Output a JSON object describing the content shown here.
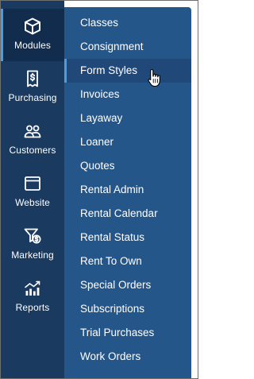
{
  "sidebar": {
    "items": [
      {
        "label": "Modules",
        "icon": "cube-icon",
        "active": true
      },
      {
        "label": "Purchasing",
        "icon": "purchase-document-icon"
      },
      {
        "label": "Customers",
        "icon": "customers-icon"
      },
      {
        "label": "Website",
        "icon": "browser-window-icon"
      },
      {
        "label": "Marketing",
        "icon": "marketing-funnel-icon"
      },
      {
        "label": "Reports",
        "icon": "chart-icon"
      }
    ]
  },
  "modules_menu": {
    "items": [
      {
        "label": "Classes"
      },
      {
        "label": "Consignment"
      },
      {
        "label": "Form Styles",
        "hovered": true
      },
      {
        "label": "Invoices"
      },
      {
        "label": "Layaway"
      },
      {
        "label": "Loaner"
      },
      {
        "label": "Quotes"
      },
      {
        "label": "Rental Admin"
      },
      {
        "label": "Rental Calendar"
      },
      {
        "label": "Rental Status"
      },
      {
        "label": "Rent To Own"
      },
      {
        "label": "Special Orders"
      },
      {
        "label": "Subscriptions"
      },
      {
        "label": "Trial Purchases"
      },
      {
        "label": "Work Orders"
      }
    ]
  },
  "colors": {
    "rail_background": "#1a3a60",
    "rail_active": "#112c4c",
    "menu_background": "#25568a",
    "menu_hover": "#20497a",
    "accent": "#4a9ee0",
    "text": "#ffffff"
  }
}
